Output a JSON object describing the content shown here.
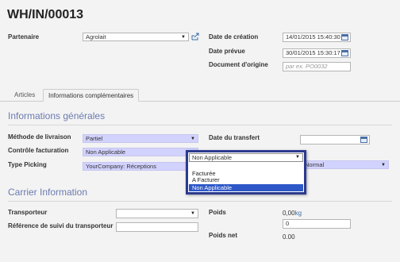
{
  "record": {
    "title": "WH/IN/00013"
  },
  "header_fields": {
    "partner_label": "Partenaire",
    "partner_value": "Agrolait",
    "creation_label": "Date de création",
    "creation_value": "14/01/2015 15:40:30",
    "scheduled_label": "Date prévue",
    "scheduled_value": "30/01/2015 15:30:17",
    "origin_label": "Document d'origine",
    "origin_placeholder": "par ex. PO0032"
  },
  "tabs": [
    {
      "label": "Articles",
      "active": false
    },
    {
      "label": "Informations complémentaires",
      "active": true
    }
  ],
  "general_info": {
    "title": "Informations générales",
    "delivery_method_label": "Méthode de livraison",
    "delivery_method_value": "Partiel",
    "invoice_control_label": "Contrôle facturation",
    "invoice_control_value": "Non Applicable",
    "picking_type_label": "Type Picking",
    "picking_type_value": "YourCompany: Réceptions",
    "transfer_date_label": "Date du transfert",
    "priority_value": "Normal"
  },
  "invoice_dropdown": {
    "selected": "Non Applicable",
    "options": [
      {
        "label": "",
        "highlighted": false
      },
      {
        "label": "Facturée",
        "highlighted": false
      },
      {
        "label": "A Facturer",
        "highlighted": false
      },
      {
        "label": "Non Applicable",
        "highlighted": true
      }
    ]
  },
  "carrier_info": {
    "title": "Carrier Information",
    "carrier_label": "Transporteur",
    "tracking_label": "Référence de suivi du transporteur",
    "weight_label": "Poids",
    "weight_value": "0,00",
    "weight_unit": "kg",
    "packages_value": "0",
    "net_weight_label": "Poids net",
    "net_weight_value": "0.00"
  },
  "colors": {
    "required_bg": "#d2d2ff",
    "dropdown_border": "#2b3a8f",
    "highlight": "#2e58c8",
    "section_title": "#6b7bb0"
  }
}
